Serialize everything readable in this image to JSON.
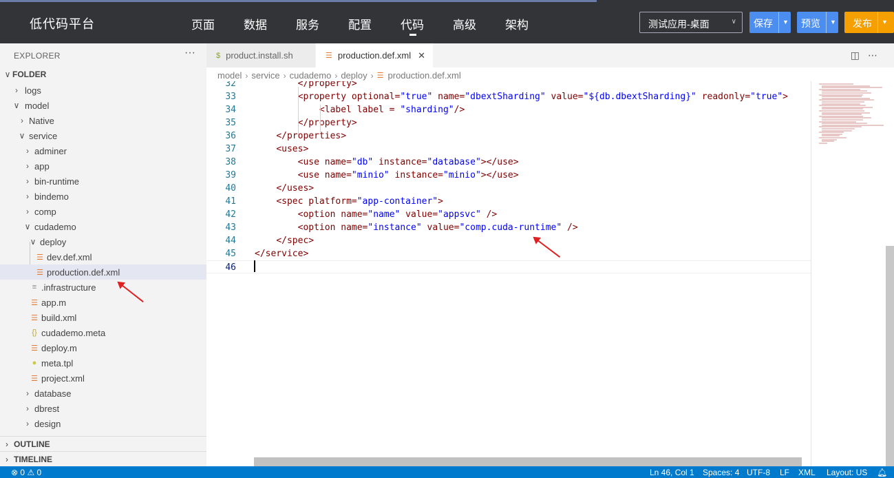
{
  "header": {
    "brand": "低代码平台",
    "nav": [
      "页面",
      "数据",
      "服务",
      "配置",
      "代码",
      "高级",
      "架构"
    ],
    "active_nav": "代码",
    "app_select": "测试应用-桌面",
    "save_label": "保存",
    "preview_label": "预览",
    "publish_label": "发布"
  },
  "sidebar": {
    "title": "EXPLORER",
    "more": "···",
    "folder_root": "FOLDER",
    "tree": [
      {
        "label": "logs",
        "type": "folder",
        "expanded": false
      },
      {
        "label": "model",
        "type": "folder",
        "expanded": true
      },
      {
        "label": "Native",
        "type": "folder",
        "expanded": false
      },
      {
        "label": "service",
        "type": "folder",
        "expanded": true
      },
      {
        "label": "adminer",
        "type": "folder",
        "expanded": false
      },
      {
        "label": "app",
        "type": "folder",
        "expanded": false
      },
      {
        "label": "bin-runtime",
        "type": "folder",
        "expanded": false
      },
      {
        "label": "bindemo",
        "type": "folder",
        "expanded": false
      },
      {
        "label": "comp",
        "type": "folder",
        "expanded": false
      },
      {
        "label": "cudademo",
        "type": "folder",
        "expanded": true
      },
      {
        "label": "deploy",
        "type": "folder",
        "expanded": true
      },
      {
        "label": "dev.def.xml",
        "type": "xml-icon"
      },
      {
        "label": "production.def.xml",
        "type": "xml-icon",
        "selected": true
      },
      {
        "label": ".infrastructure",
        "type": "lines-icon"
      },
      {
        "label": "app.m",
        "type": "xml-icon"
      },
      {
        "label": "build.xml",
        "type": "xml-icon"
      },
      {
        "label": "cudademo.meta",
        "type": "json-icon"
      },
      {
        "label": "deploy.m",
        "type": "xml-icon"
      },
      {
        "label": "meta.tpl",
        "type": "bulb-icon"
      },
      {
        "label": "project.xml",
        "type": "xml-icon"
      },
      {
        "label": "database",
        "type": "folder",
        "expanded": false
      },
      {
        "label": "dbrest",
        "type": "folder",
        "expanded": false
      },
      {
        "label": "design",
        "type": "folder",
        "expanded": false
      }
    ],
    "outline_label": "OUTLINE",
    "timeline_label": "TIMELINE"
  },
  "editor": {
    "tabs": [
      {
        "label": "product.install.sh",
        "icon": "dollar-icon",
        "active": false
      },
      {
        "label": "production.def.xml",
        "icon": "xml-icon",
        "active": true
      }
    ],
    "breadcrumb": [
      "model",
      "service",
      "cudademo",
      "deploy",
      "production.def.xml"
    ],
    "lines": [
      {
        "n": "32",
        "text": "        </property>"
      },
      {
        "n": "33",
        "text": "        <property optional=\"true\" name=\"dbextSharding\" value=\"${db.dbextSharding}\" readonly=\"true\">"
      },
      {
        "n": "34",
        "text": "            <label label = \"sharding\"/>"
      },
      {
        "n": "35",
        "text": "        </property>"
      },
      {
        "n": "36",
        "text": "    </properties>"
      },
      {
        "n": "37",
        "text": "    <uses>"
      },
      {
        "n": "38",
        "text": "        <use name=\"db\" instance=\"database\"></use>"
      },
      {
        "n": "39",
        "text": "        <use name=\"minio\" instance=\"minio\"></use>"
      },
      {
        "n": "40",
        "text": "    </uses>"
      },
      {
        "n": "41",
        "text": "    <spec platform=\"app-container\">"
      },
      {
        "n": "42",
        "text": "        <option name=\"name\" value=\"appsvc\" />"
      },
      {
        "n": "43",
        "text": "        <option name=\"instance\" value=\"comp.cuda-runtime\" />"
      },
      {
        "n": "44",
        "text": "    </spec>"
      },
      {
        "n": "45",
        "text": "</service>"
      },
      {
        "n": "46",
        "text": ""
      }
    ]
  },
  "status": {
    "errors": "0",
    "warnings": "0",
    "position": "Ln 46, Col 1",
    "spaces": "Spaces: 4",
    "encoding": "UTF-8",
    "eol": "LF",
    "language": "XML",
    "layout": "Layout: US"
  },
  "colors": {
    "topbar_bg": "#333438",
    "primary_button": "#4b8ef0",
    "publish_button": "#f5a000",
    "statusbar": "#007acc",
    "xml_tag": "#800000",
    "xml_attr": "#e50000",
    "xml_value": "#0000ff",
    "arrow": "#e02020"
  }
}
